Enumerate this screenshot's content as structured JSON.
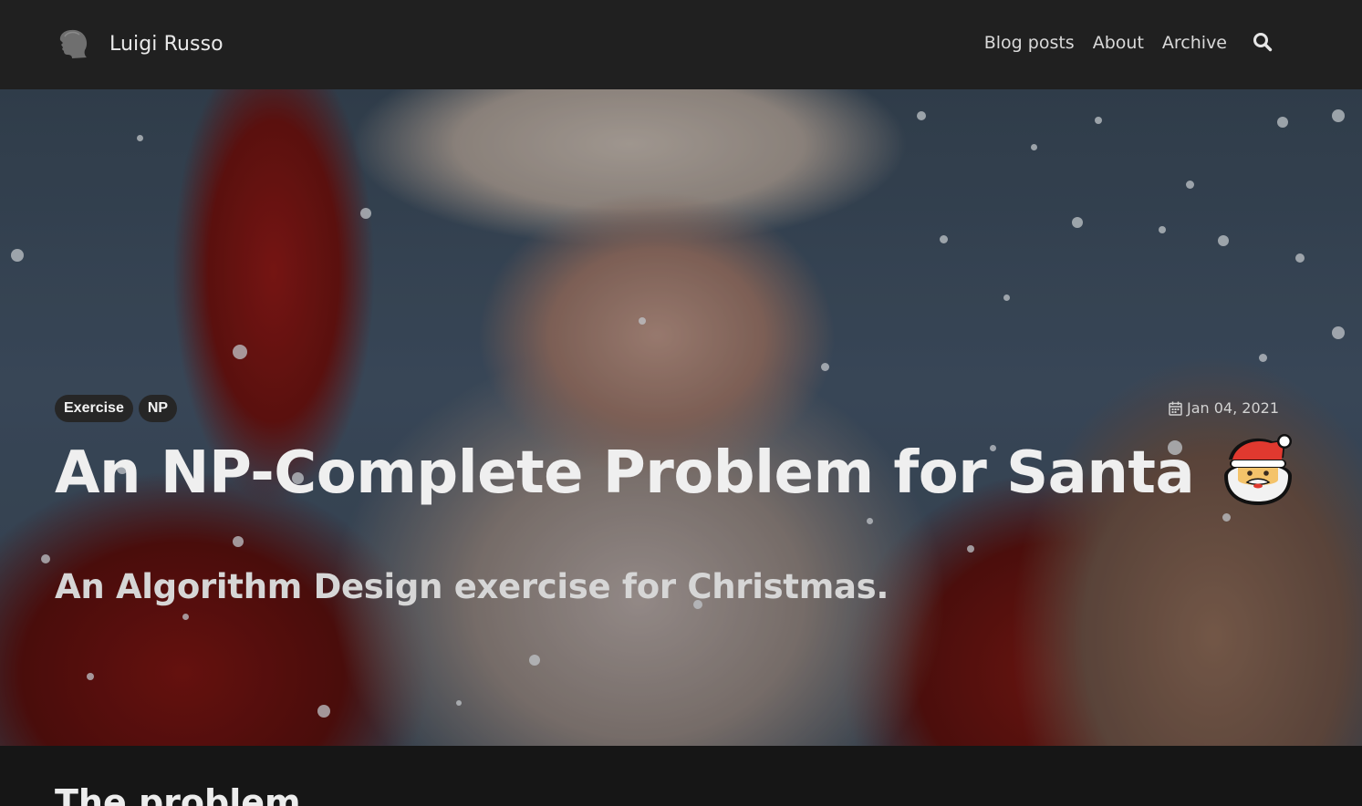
{
  "header": {
    "brand": "Luigi Russo",
    "nav": [
      "Blog posts",
      "About",
      "Archive"
    ],
    "search_icon": "search-icon",
    "logo_icon": "head-silhouette-icon"
  },
  "post": {
    "tags": [
      "Exercise",
      "NP"
    ],
    "date": "Jan 04, 2021",
    "date_icon": "calendar-icon",
    "title": "An NP-Complete Problem for Santa",
    "title_emoji": "santa-emoji-icon",
    "subtitle": "An Algorithm Design exercise for Christmas.",
    "hero_image": "Santa Claus holding a paper scroll in falling snow"
  },
  "content": {
    "section_heading": "The problem"
  },
  "colors": {
    "navbar_bg": "#202020",
    "page_bg": "#161616",
    "tag_bg": "#262626",
    "text": "#efefef"
  }
}
